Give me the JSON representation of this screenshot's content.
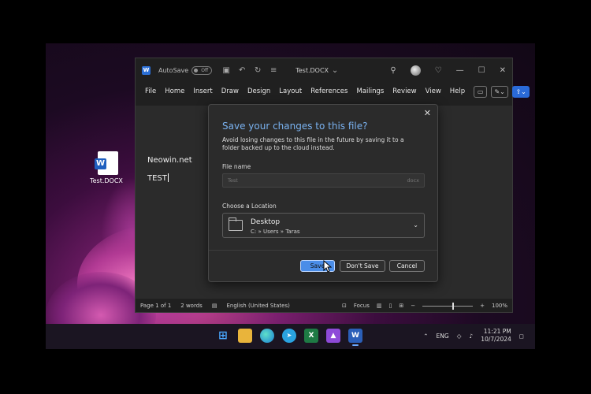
{
  "desktop": {
    "icon_label": "Test.DOCX"
  },
  "word": {
    "app_icon": "W",
    "autosave_label": "AutoSave",
    "autosave_state": "Off",
    "doc_title": "Test.DOCX",
    "menu": [
      "File",
      "Home",
      "Insert",
      "Draw",
      "Design",
      "Layout",
      "References",
      "Mailings",
      "Review",
      "View",
      "Help"
    ],
    "doc_lines": [
      "Neowin.net",
      "TEST"
    ],
    "status": {
      "page": "Page 1 of 1",
      "words": "2 words",
      "language": "English (United States)",
      "focus": "Focus",
      "zoom": "100%"
    }
  },
  "dialog": {
    "title": "Save your changes to this file?",
    "description": "Avoid losing changes to this file in the future by saving it to a folder backed up to the cloud instead.",
    "file_name_label": "File name",
    "file_name_value": "Test",
    "file_ext": "docx",
    "location_label": "Choose a Location",
    "location_name": "Desktop",
    "location_path": "C: » Users » Taras",
    "save_label": "Save",
    "dont_save_label": "Don't Save",
    "cancel_label": "Cancel"
  },
  "taskbar": {
    "lang": "ENG",
    "time": "11:21 PM",
    "date": "10/7/2024"
  },
  "colors": {
    "accent": "#4a8de8",
    "dialog_title": "#7ab2f0",
    "word_blue": "#2b5fb8"
  }
}
